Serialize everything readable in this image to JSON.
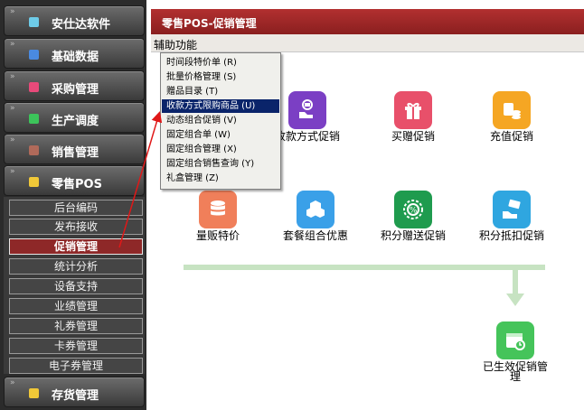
{
  "sidebar": {
    "categories": [
      {
        "label": "安仕达软件",
        "icon": "sky-blue-square-icon"
      },
      {
        "label": "基础数据",
        "icon": "blue-square-icon"
      },
      {
        "label": "采购管理",
        "icon": "pink-square-icon"
      },
      {
        "label": "生产调度",
        "icon": "green-square-icon"
      },
      {
        "label": "销售管理",
        "icon": "brown-square-icon"
      },
      {
        "label": "零售POS",
        "icon": "yellow-square-icon"
      },
      {
        "label": "存货管理",
        "icon": "yellow-square-icon"
      }
    ],
    "subitems": [
      "后台编码",
      "发布接收",
      "促销管理",
      "统计分析",
      "设备支持",
      "业绩管理",
      "礼券管理",
      "卡券管理",
      "电子券管理"
    ],
    "active_subitem": "促销管理"
  },
  "main": {
    "title": "零售POS-促销管理",
    "menu_label": "辅助功能",
    "dropdown": [
      "时间段特价单 (R)",
      "批量价格管理 (S)",
      "赠品目录 (T)",
      "收款方式限购商品 (U)",
      "动态组合促销 (V)",
      "固定组合单 (W)",
      "固定组合管理 (X)",
      "固定组合销售查询 (Y)",
      "礼盒管理 (Z)"
    ],
    "highlighted_dropdown_item": "收款方式限购商品 (U)",
    "tiles": {
      "t1": {
        "label": "收款方式促销",
        "icon": "hand-coin-icon"
      },
      "t2": {
        "label": "买赠促销",
        "icon": "gift-icon"
      },
      "t3": {
        "label": "充值促销",
        "icon": "coins-icon"
      },
      "t4": {
        "label": "量贩特价",
        "icon": "database-icon"
      },
      "t5": {
        "label": "套餐组合优惠",
        "icon": "cubes-icon"
      },
      "t6": {
        "label": "积分赠送促销",
        "icon": "percent-badge-icon"
      },
      "t7": {
        "label": "积分抵扣促销",
        "icon": "cash-hand-icon"
      },
      "t8": {
        "label": "已生效促销管理",
        "icon": "calendar-clock-icon"
      }
    }
  },
  "colors": {
    "title_bar": "#a82a2a",
    "active_subitem": "#8e2828",
    "highlight": "#0a246a",
    "connector": "#c7e3c2",
    "annotation_arrow": "#e01818"
  }
}
